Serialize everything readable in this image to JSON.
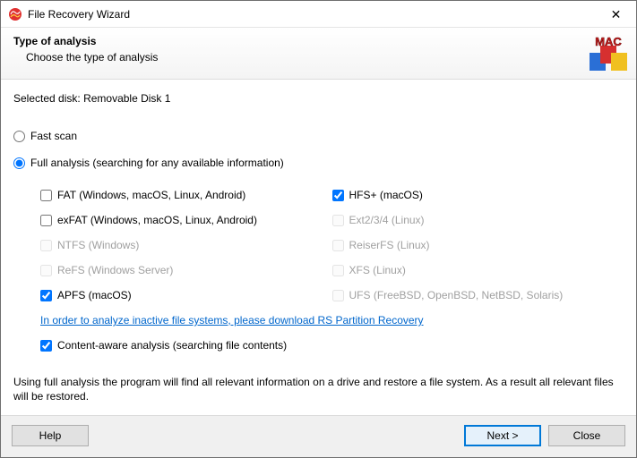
{
  "window": {
    "title": "File Recovery Wizard",
    "close_symbol": "✕"
  },
  "header": {
    "title": "Type of analysis",
    "subtitle": "Choose the type of analysis"
  },
  "body": {
    "selected_disk_label": "Selected disk:",
    "selected_disk_value": "Removable Disk 1",
    "radio_fast": "Fast scan",
    "radio_full": "Full analysis (searching for any available information)",
    "fs_left": [
      {
        "label": "FAT (Windows, macOS, Linux, Android)",
        "checked": false,
        "enabled": true
      },
      {
        "label": "exFAT (Windows, macOS, Linux, Android)",
        "checked": false,
        "enabled": true
      },
      {
        "label": "NTFS (Windows)",
        "checked": false,
        "enabled": false
      },
      {
        "label": "ReFS (Windows Server)",
        "checked": false,
        "enabled": false
      },
      {
        "label": "APFS (macOS)",
        "checked": true,
        "enabled": true
      }
    ],
    "fs_right": [
      {
        "label": "HFS+ (macOS)",
        "checked": true,
        "enabled": true
      },
      {
        "label": "Ext2/3/4 (Linux)",
        "checked": false,
        "enabled": false
      },
      {
        "label": "ReiserFS (Linux)",
        "checked": false,
        "enabled": false
      },
      {
        "label": "XFS (Linux)",
        "checked": false,
        "enabled": false
      },
      {
        "label": "UFS (FreeBSD, OpenBSD, NetBSD, Solaris)",
        "checked": false,
        "enabled": false
      }
    ],
    "link_note": "In order to analyze inactive file systems, please download RS Partition Recovery",
    "content_aware_label": "Content-aware analysis (searching file contents)",
    "content_aware_checked": true,
    "description": "Using full analysis the program will find all relevant information on a drive and restore a file system. As a result all relevant files will be restored."
  },
  "footer": {
    "help": "Help",
    "next": "Next >",
    "close": "Close"
  }
}
